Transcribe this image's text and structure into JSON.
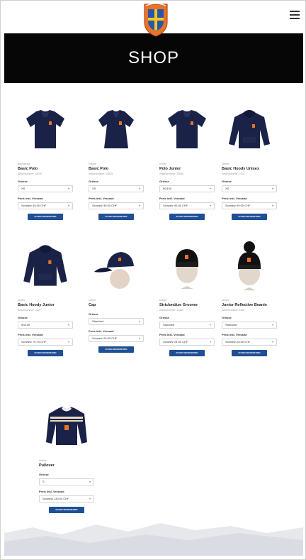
{
  "header": {
    "menu_icon": "hamburger-icon",
    "logo_icon": "club-crest-icon"
  },
  "hero": {
    "title": "SHOP"
  },
  "labels": {
    "size": "Grösse",
    "price": "Preis inkl. Versand",
    "cart_button": "IN DEN WARENKORB"
  },
  "colors": {
    "navy": "#1b2247",
    "button": "#1f4f95",
    "hero_bg": "#060606"
  },
  "products": [
    {
      "category": "Bekleidung",
      "name": "Basic Polo",
      "article": "Artikelnummer: 28030",
      "size": "XS",
      "price": "Schweiz 39.00 CHF"
    },
    {
      "category": "Frauen",
      "name": "Basic Polo",
      "article": "Artikelnummer: 28025",
      "size": "XS",
      "price": "Schweiz 39.00 CHF"
    },
    {
      "category": "Kinder",
      "name": "Polo Junior",
      "article": "Artikelnummer: 28035",
      "size": "90/100",
      "price": "Schweiz 45.00 CHF"
    },
    {
      "category": "Unisex",
      "name": "Basic Hoody Unisex",
      "article": "Artikelnummer: 2203",
      "size": "XS",
      "price": "Schweiz 59.00 CHF"
    },
    {
      "category": "Kinder",
      "name": "Basic Hoody Junior",
      "article": "Artikelnummer: 2205",
      "size": "90/100",
      "price": "Schweiz 75.70 CHF"
    },
    {
      "category": "Unisex",
      "name": "Cap",
      "article": "",
      "size": "Standard",
      "price": "Schweiz 29.00 CHF"
    },
    {
      "category": "Unisex",
      "name": "Strickmütze Groover",
      "article": "Artikelnummer: 22340",
      "size": "Standard",
      "price": "Schweiz 24.00 CHF"
    },
    {
      "category": "Unisex",
      "name": "Junior Reflective Beanie",
      "article": "Artikelnummer: 4655",
      "size": "Standard",
      "price": "Schweiz 28.00 CHF"
    },
    {
      "category": "Unisex",
      "name": "Pullover",
      "article": "",
      "size": "S",
      "price": "Schweiz 130.00 CHF"
    }
  ]
}
